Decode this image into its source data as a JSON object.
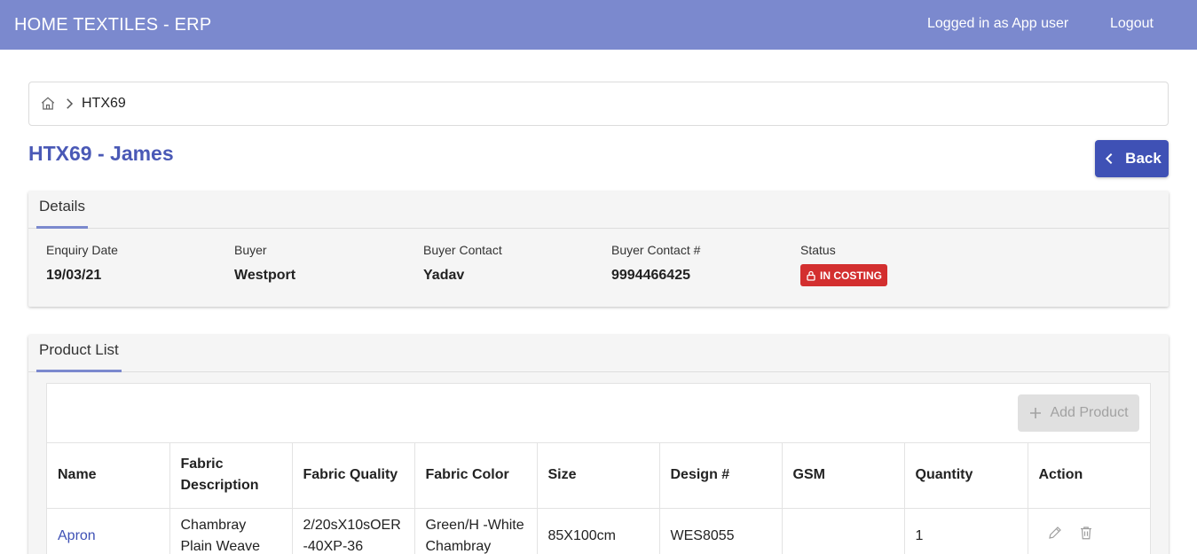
{
  "app": {
    "title": "HOME TEXTILES - ERP",
    "login_text": "Logged in as App user",
    "logout_label": "Logout"
  },
  "breadcrumb": {
    "current": "HTX69"
  },
  "page": {
    "title": "HTX69 - James",
    "back_label": "Back"
  },
  "details": {
    "tab_label": "Details",
    "enquiry_date_label": "Enquiry Date",
    "enquiry_date": "19/03/21",
    "buyer_label": "Buyer",
    "buyer": "Westport",
    "buyer_contact_label": "Buyer Contact",
    "buyer_contact": "Yadav",
    "buyer_contact_no_label": "Buyer Contact #",
    "buyer_contact_no": "9994466425",
    "status_label": "Status",
    "status": "IN COSTING",
    "status_color": "#d32f2f"
  },
  "products": {
    "tab_label": "Product List",
    "add_label": "Add Product",
    "columns": [
      "Name",
      "Fabric Description",
      "Fabric Quality",
      "Fabric Color",
      "Size",
      "Design #",
      "GSM",
      "Quantity",
      "Action"
    ],
    "rows": [
      {
        "name": "Apron",
        "fabric_description": "Chambray Plain Weave",
        "fabric_quality": "2/20sX10sOER-40XP-36",
        "fabric_color": "Green/H -White Chambray",
        "size": "85X100cm",
        "design": "WES8055",
        "gsm": "",
        "quantity": "1"
      }
    ]
  },
  "icons": {
    "home": "home-icon",
    "breadcrumb_separator": "chevron-right-icon",
    "back": "chevron-left-icon",
    "status": "lock-icon",
    "add": "plus-icon",
    "edit": "pencil-icon",
    "delete": "trash-icon"
  },
  "colors": {
    "header": "#7b89ce",
    "primary": "#3f51b5",
    "title": "#4a59b6"
  }
}
